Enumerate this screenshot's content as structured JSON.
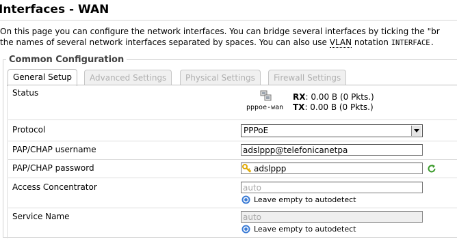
{
  "page": {
    "title": "Interfaces - WAN",
    "description_line1": "On this page you can configure the network interfaces. You can bridge several interfaces by ticking the \"br",
    "description_line2_a": "the names of several network interfaces separated by spaces. You can also use ",
    "description_line2_abbr": "VLAN",
    "description_line2_b": " notation ",
    "description_line2_code": "INTERFACE."
  },
  "section": {
    "legend": "Common Configuration"
  },
  "tabs": [
    {
      "label": "General Setup",
      "active": true
    },
    {
      "label": "Advanced Settings",
      "active": false
    },
    {
      "label": "Physical Settings",
      "active": false
    },
    {
      "label": "Firewall Settings",
      "active": false
    }
  ],
  "status": {
    "label": "Status",
    "interface_name": "pppoe-wan",
    "rx_label": "RX",
    "rx_value": ": 0.00 B (0 Pkts.)",
    "tx_label": "TX",
    "tx_value": ": 0.00 B (0 Pkts.)"
  },
  "fields": {
    "protocol": {
      "label": "Protocol",
      "value": "PPPoE"
    },
    "username": {
      "label": "PAP/CHAP username",
      "value": "adslppp@telefonicanetpa"
    },
    "password": {
      "label": "PAP/CHAP password",
      "value": "adslppp"
    },
    "access_concentrator": {
      "label": "Access Concentrator",
      "placeholder": "auto",
      "hint": "Leave empty to autodetect"
    },
    "service_name": {
      "label": "Service Name",
      "placeholder": "auto",
      "hint": "Leave empty to autodetect"
    }
  },
  "icons": {
    "interface": "network-interface-icon",
    "key": "key-icon",
    "refresh": "refresh-icon",
    "help": "help-icon"
  },
  "colors": {
    "tab_inactive_text": "#b0b0b0",
    "legend_text": "#404040",
    "help_icon": "#3a7bd5",
    "refresh_icon": "#3a9a2a",
    "key_icon": "#e0a800"
  }
}
